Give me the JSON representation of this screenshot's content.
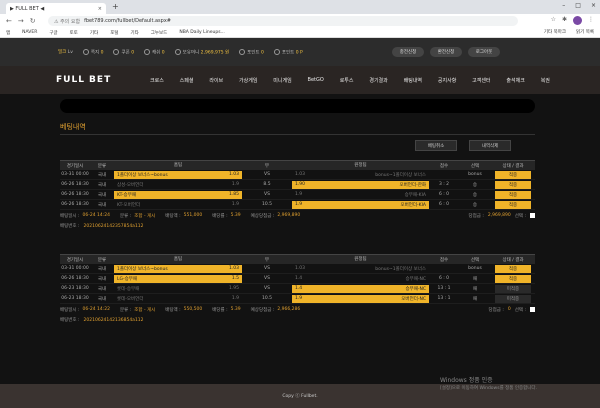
{
  "browser": {
    "tab_title": "▶ FULL BET ◀",
    "tab_close": "×",
    "new_tab": "+",
    "window_controls": [
      "–",
      "□",
      "×"
    ],
    "url_warning": "⚠ 주의 요함",
    "url": "fbet789.com/fullbet/Default.aspx#",
    "bookmarks": [
      "앱",
      "NAVER",
      "구글",
      "토토",
      "기타",
      "포털",
      "기타",
      "그누보드",
      "NBA Daily Lineups..."
    ],
    "bookmarks_right": [
      "기타 북마크",
      "읽기 목록"
    ]
  },
  "topbar": {
    "user": "밀크",
    "level": "Lv",
    "stats": [
      {
        "label": "쪽지",
        "value": "0"
      },
      {
        "label": "쿠폰",
        "value": "0"
      },
      {
        "label": "캐쉬",
        "value": "0"
      },
      {
        "label": "보유머니",
        "value": "2,969,975 원"
      },
      {
        "label": "포인트",
        "value": "0"
      },
      {
        "label": "포인트",
        "value": "0 P"
      }
    ],
    "buttons": [
      "충전신청",
      "환전신청",
      "로그아웃"
    ]
  },
  "nav": {
    "logo": "FULL BET",
    "items": [
      "크로스",
      "스페셜",
      "라이브",
      "가상게임",
      "미니게임",
      "BetGO",
      "로투스",
      "경기결과",
      "배팅내역",
      "공지사항",
      "고객센터",
      "출석체크",
      "복권"
    ]
  },
  "page": {
    "title": "베팅내역",
    "actions": [
      "배팅취소",
      "내역삭제"
    ]
  },
  "table_headers": [
    "경기일시",
    "분류",
    "홈팀",
    "무",
    "원정팀",
    "점수",
    "선택",
    "상태 / 결과"
  ],
  "slips": [
    {
      "rows": [
        {
          "time": "03-31 00:00",
          "league": "국내",
          "home": "1폴더이상 보너스~bonus",
          "home_odds": "1.03",
          "draw": "VS",
          "away": "bonus~1폴더이상 보너스",
          "away_odds": "1.03",
          "score": "",
          "pick": "bonus",
          "result": "적중",
          "home_sel": true,
          "away_sel": false
        },
        {
          "time": "06-26 18:30",
          "league": "국내",
          "home": "삼성-오버언더",
          "home_odds": "1.9",
          "draw": "8.5",
          "away": "오버언더-한화",
          "away_odds": "1.90",
          "score": "3 : 2",
          "pick": "승",
          "result": "적중",
          "home_sel": false,
          "away_sel": true
        },
        {
          "time": "06-26 18:30",
          "league": "국내",
          "home": "KT-승무패",
          "home_odds": "1.85",
          "draw": "VS",
          "away": "승무패-KIA",
          "away_odds": "1.9",
          "score": "6 : 0",
          "pick": "승",
          "result": "적중",
          "home_sel": true,
          "away_sel": false
        },
        {
          "time": "06-26 18:30",
          "league": "국내",
          "home": "KT-오버언더",
          "home_odds": "1.9",
          "draw": "10.5",
          "away": "오버언더-KIA",
          "away_odds": "1.9",
          "score": "6 : 0",
          "pick": "승",
          "result": "적중",
          "home_sel": false,
          "away_sel": true
        }
      ],
      "bet_time": "06-24 14:24",
      "category": "조합 - 게시",
      "bet_amount": "551,000",
      "odds": "5.39",
      "expected": "2,969,890",
      "win_amount": "2,969,890",
      "bet_no": "20210624142357854a112"
    },
    {
      "rows": [
        {
          "time": "03-31 00:00",
          "league": "국내",
          "home": "1폴더이상 보너스~bonus",
          "home_odds": "1.03",
          "draw": "VS",
          "away": "bonus~1폴더이상 보너스",
          "away_odds": "1.03",
          "score": "",
          "pick": "bonus",
          "result": "적중",
          "home_sel": true,
          "away_sel": false
        },
        {
          "time": "06-26 18:30",
          "league": "국내",
          "home": "LG-승무패",
          "home_odds": "1.5",
          "draw": "VS",
          "away": "승무패-NC",
          "away_odds": "1.4",
          "score": "6 : 0",
          "pick": "패",
          "result": "적중",
          "home_sel": true,
          "away_sel": false
        },
        {
          "time": "06-23 18:30",
          "league": "국내",
          "home": "롯데-승무패",
          "home_odds": "1.95",
          "draw": "VS",
          "away": "승무패-NC",
          "away_odds": "1.4",
          "score": "13 : 1",
          "pick": "패",
          "result": "미적중",
          "home_sel": false,
          "away_sel": true
        },
        {
          "time": "06-23 18:30",
          "league": "국내",
          "home": "롯데-오버언더",
          "home_odds": "1.9",
          "draw": "10.5",
          "away": "오버언더-NC",
          "away_odds": "1.9",
          "score": "13 : 1",
          "pick": "패",
          "result": "미적중",
          "home_sel": false,
          "away_sel": true
        }
      ],
      "bet_time": "06-24 14:22",
      "category": "조합 - 게시",
      "bet_amount": "550,500",
      "odds": "5.39",
      "expected": "2,966,286",
      "win_amount": "0",
      "bet_no": "20210624142136854a112"
    }
  ],
  "labels": {
    "bet_time": "배팅일시 :",
    "category": "분류 :",
    "bet_amount": "배팅액 :",
    "odds": "배당률 :",
    "expected": "예상당첨금 :",
    "win": "당첨금 :",
    "select": "선택 :",
    "bet_no": "배팅번호 :"
  },
  "footer": "Copy ⓒ Fullbet.",
  "windows_watermark": [
    "Windows 정품 인증",
    "[설정]으로 이동하여 Windows를 정품 인증합니다."
  ]
}
